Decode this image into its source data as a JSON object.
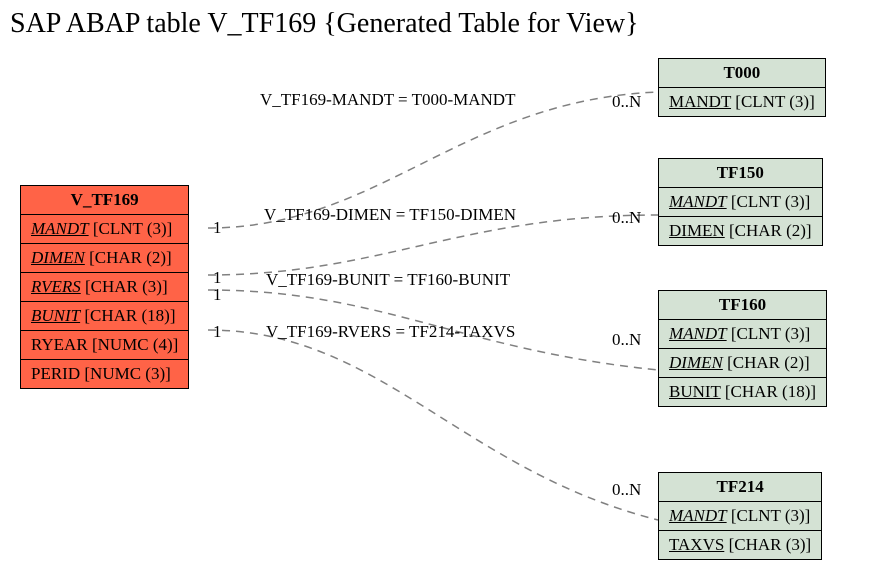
{
  "title": "SAP ABAP table V_TF169 {Generated Table for View}",
  "main_entity": {
    "name": "V_TF169",
    "fields": [
      {
        "name": "MANDT",
        "type": "[CLNT (3)]",
        "key": true
      },
      {
        "name": "DIMEN",
        "type": "[CHAR (2)]",
        "key": true
      },
      {
        "name": "RVERS",
        "type": "[CHAR (3)]",
        "key": true
      },
      {
        "name": "BUNIT",
        "type": "[CHAR (18)]",
        "key": true
      },
      {
        "name": "RYEAR",
        "type": "[NUMC (4)]",
        "key": false
      },
      {
        "name": "PERID",
        "type": "[NUMC (3)]",
        "key": false
      }
    ]
  },
  "related_entities": [
    {
      "name": "T000",
      "fields": [
        {
          "name": "MANDT",
          "type": "[CLNT (3)]",
          "key": true
        }
      ]
    },
    {
      "name": "TF150",
      "fields": [
        {
          "name": "MANDT",
          "type": "[CLNT (3)]",
          "key": true
        },
        {
          "name": "DIMEN",
          "type": "[CHAR (2)]",
          "key": false
        }
      ]
    },
    {
      "name": "TF160",
      "fields": [
        {
          "name": "MANDT",
          "type": "[CLNT (3)]",
          "key": true
        },
        {
          "name": "DIMEN",
          "type": "[CHAR (2)]",
          "key": true
        },
        {
          "name": "BUNIT",
          "type": "[CHAR (18)]",
          "key": false
        }
      ]
    },
    {
      "name": "TF214",
      "fields": [
        {
          "name": "MANDT",
          "type": "[CLNT (3)]",
          "key": true
        },
        {
          "name": "TAXVS",
          "type": "[CHAR (3)]",
          "key": false
        }
      ]
    }
  ],
  "relations": [
    {
      "label": "V_TF169-MANDT = T000-MANDT",
      "left_card": "1",
      "right_card": "0..N"
    },
    {
      "label": "V_TF169-DIMEN = TF150-DIMEN",
      "left_card": "1",
      "right_card": "0..N"
    },
    {
      "label": "V_TF169-BUNIT = TF160-BUNIT",
      "left_card": "1",
      "right_card": ""
    },
    {
      "label": "V_TF169-RVERS = TF214-TAXVS",
      "left_card": "1",
      "right_card": "0..N"
    }
  ],
  "extra_cards": {
    "tf160_right": "0..N"
  }
}
